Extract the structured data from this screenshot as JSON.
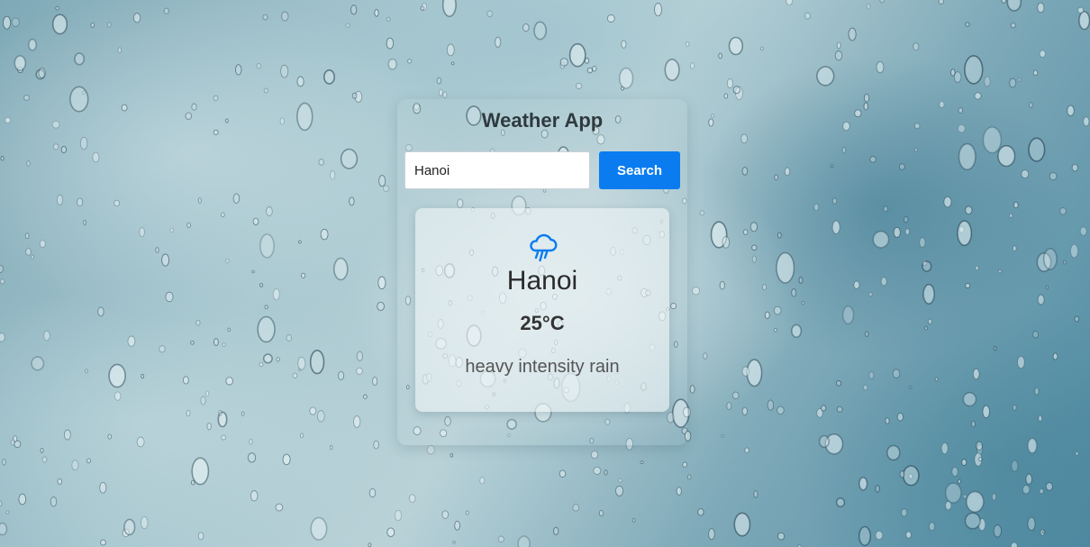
{
  "app": {
    "title": "Weather App"
  },
  "search": {
    "value": "Hanoi",
    "button_label": "Search"
  },
  "weather": {
    "icon": "rain-cloud-icon",
    "city": "Hanoi",
    "temperature": "25°C",
    "description": "heavy intensity rain"
  },
  "colors": {
    "accent": "#0a7cf0",
    "icon": "#0a7cf0"
  }
}
